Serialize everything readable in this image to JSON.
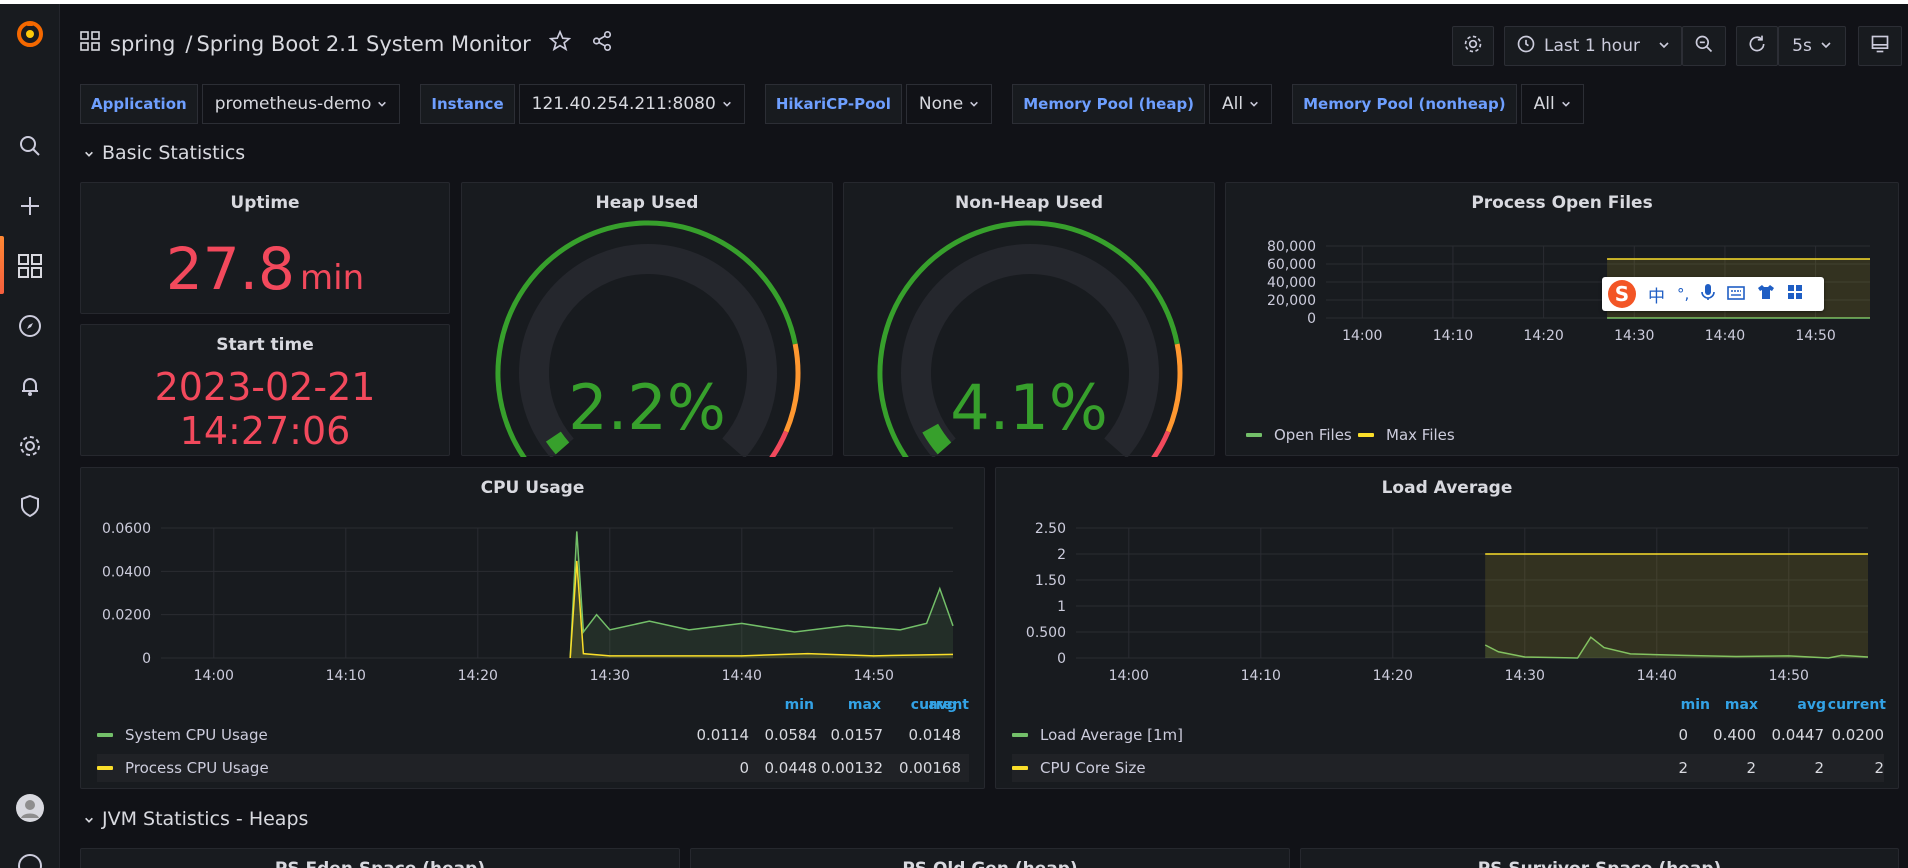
{
  "header": {
    "folder": "spring",
    "separator": "/",
    "title": "Spring Boot 2.1 System Monitor",
    "time_range": "Last 1 hour",
    "refresh": "5s"
  },
  "variables": [
    {
      "label": "Application",
      "value": "prometheus-demo"
    },
    {
      "label": "Instance",
      "value": "121.40.254.211:8080"
    },
    {
      "label": "HikariCP-Pool",
      "value": "None"
    },
    {
      "label": "Memory Pool (heap)",
      "value": "All"
    },
    {
      "label": "Memory Pool (nonheap)",
      "value": "All"
    }
  ],
  "rows": {
    "basic": "Basic Statistics",
    "jvm_heaps": "JVM Statistics - Heaps"
  },
  "panels": {
    "uptime": {
      "title": "Uptime",
      "value": "27.8",
      "unit": "min"
    },
    "start_time": {
      "title": "Start time",
      "date": "2023-02-21",
      "time": "14:27:06"
    },
    "heap_used": {
      "title": "Heap Used",
      "value": "2.2%",
      "percent": 2.2
    },
    "nonheap_used": {
      "title": "Non-Heap Used",
      "value": "4.1%",
      "percent": 4.1
    },
    "open_files": {
      "title": "Process Open Files",
      "legend": [
        "Open Files",
        "Max Files"
      ]
    },
    "cpu": {
      "title": "CPU Usage",
      "cols": [
        "min",
        "max",
        "avg",
        "current"
      ],
      "rows": [
        {
          "name": "System CPU Usage",
          "min": "0.0114",
          "max": "0.0584",
          "avg": "0.0157",
          "current": "0.0148"
        },
        {
          "name": "Process CPU Usage",
          "min": "0",
          "max": "0.0448",
          "avg": "0.00132",
          "current": "0.00168"
        }
      ]
    },
    "load": {
      "title": "Load Average",
      "cols": [
        "min",
        "max",
        "avg",
        "current"
      ],
      "rows": [
        {
          "name": "Load Average [1m]",
          "min": "0",
          "max": "0.400",
          "avg": "0.0447",
          "current": "0.0200"
        },
        {
          "name": "CPU Core Size",
          "min": "2",
          "max": "2",
          "avg": "2",
          "current": "2"
        }
      ]
    },
    "bottom": [
      "PS Eden Space (heap)",
      "PS Old Gen (heap)",
      "PS Survivor Space (heap)"
    ]
  },
  "ime_toolbar": {
    "chars": [
      "中",
      "°,"
    ]
  },
  "colors": {
    "green": "#73bf69",
    "yellow": "#fade2a",
    "red": "#f2495c",
    "gauge_green": "#37872d",
    "orange": "#ff9830",
    "blue": "#6e9fff"
  },
  "chart_data": [
    {
      "type": "line",
      "title": "Process Open Files",
      "x_ticks": [
        "14:00",
        "14:10",
        "14:20",
        "14:30",
        "14:40",
        "14:50"
      ],
      "y_ticks": [
        "0",
        "20,000",
        "40,000",
        "60,000",
        "80,000"
      ],
      "ylim": [
        0,
        80000
      ],
      "series": [
        {
          "name": "Open Files",
          "x": [
            "14:27",
            "14:56"
          ],
          "values": [
            25,
            25
          ]
        },
        {
          "name": "Max Files",
          "x": [
            "14:27",
            "14:56"
          ],
          "values": [
            65535,
            65535
          ]
        }
      ]
    },
    {
      "type": "line",
      "title": "CPU Usage",
      "x_ticks": [
        "14:00",
        "14:10",
        "14:20",
        "14:30",
        "14:40",
        "14:50"
      ],
      "y_ticks": [
        "0",
        "0.0200",
        "0.0400",
        "0.0600"
      ],
      "ylim": [
        0,
        0.06
      ],
      "series": [
        {
          "name": "System CPU Usage",
          "x": [
            "14:27",
            "14:27.5",
            "14:28",
            "14:29",
            "14:30",
            "14:33",
            "14:36",
            "14:40",
            "14:44",
            "14:48",
            "14:52",
            "14:54",
            "14:55",
            "14:56"
          ],
          "values": [
            0.0,
            0.0584,
            0.012,
            0.02,
            0.013,
            0.017,
            0.013,
            0.016,
            0.012,
            0.015,
            0.013,
            0.016,
            0.032,
            0.0148
          ]
        },
        {
          "name": "Process CPU Usage",
          "x": [
            "14:27",
            "14:27.5",
            "14:28",
            "14:30",
            "14:35",
            "14:40",
            "14:45",
            "14:50",
            "14:56"
          ],
          "values": [
            0.0,
            0.0448,
            0.002,
            0.001,
            0.001,
            0.001,
            0.002,
            0.001,
            0.00168
          ]
        }
      ]
    },
    {
      "type": "line",
      "title": "Load Average",
      "x_ticks": [
        "14:00",
        "14:10",
        "14:20",
        "14:30",
        "14:40",
        "14:50"
      ],
      "y_ticks": [
        "0",
        "0.500",
        "1",
        "1.50",
        "2",
        "2.50"
      ],
      "ylim": [
        0,
        2.5
      ],
      "series": [
        {
          "name": "Load Average [1m]",
          "x": [
            "14:27",
            "14:28",
            "14:30",
            "14:34",
            "14:35",
            "14:36",
            "14:38",
            "14:42",
            "14:46",
            "14:50",
            "14:53",
            "14:54",
            "14:56"
          ],
          "values": [
            0.25,
            0.12,
            0.02,
            0.0,
            0.4,
            0.2,
            0.08,
            0.05,
            0.03,
            0.04,
            0.0,
            0.05,
            0.02
          ]
        },
        {
          "name": "CPU Core Size",
          "x": [
            "14:27",
            "14:56"
          ],
          "values": [
            2,
            2
          ]
        }
      ]
    }
  ]
}
